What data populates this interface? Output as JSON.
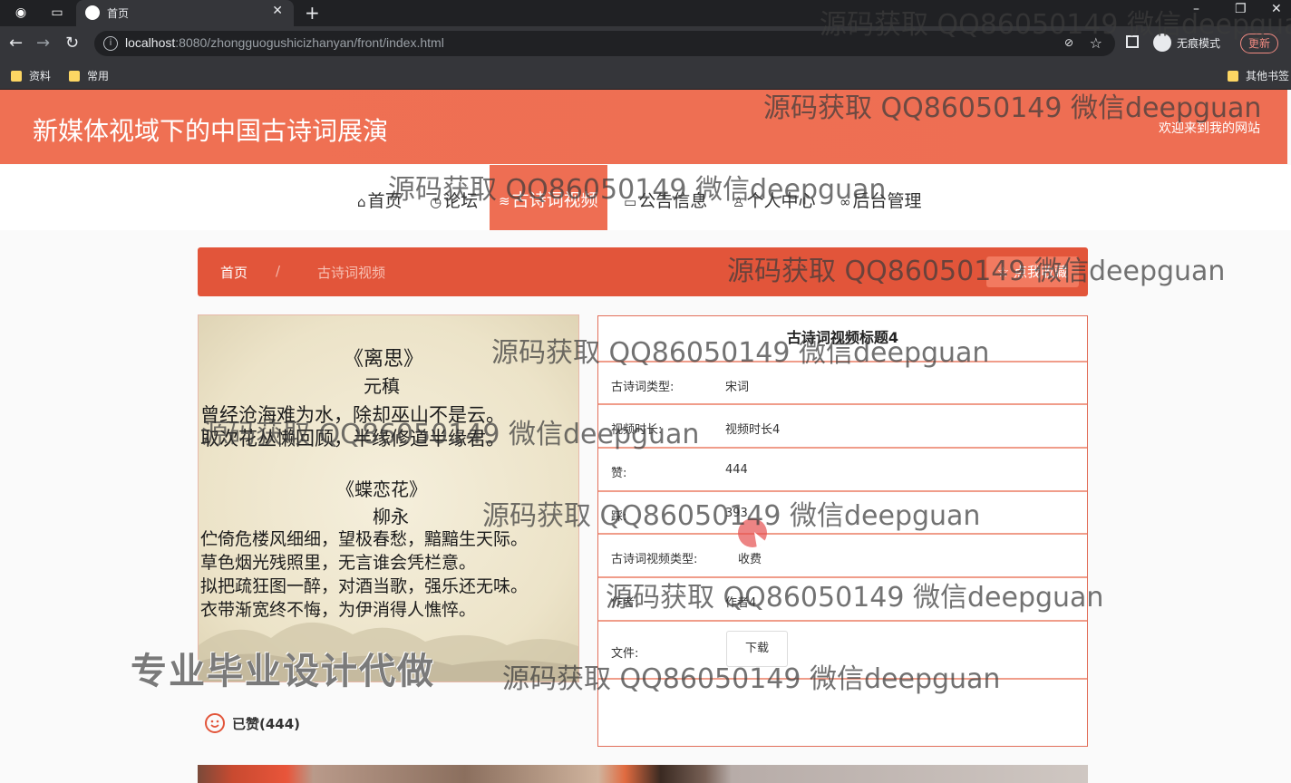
{
  "browser": {
    "tab_title": "首页",
    "url_host": "localhost",
    "url_rest": ":8080/zhongguogushicizhanyan/front/index.html",
    "incognito_label": "无痕模式",
    "update_label": "更新",
    "bookmarks": [
      "资料",
      "常用"
    ],
    "other_bookmarks": "其他书签"
  },
  "site": {
    "title": "新媒体视域下的中国古诗词展演",
    "welcome": "欢迎来到我的网站"
  },
  "nav": {
    "items": [
      "首页",
      "论坛",
      "古诗词视频",
      "公告信息",
      "个人中心",
      "后台管理"
    ],
    "active": "古诗词视频"
  },
  "breadcrumb": {
    "home": "首页",
    "separator": "/",
    "current": "古诗词视频",
    "collect": "☆ 点我收藏"
  },
  "poem": {
    "title1": "《离思》",
    "author1": "元稹",
    "line1": "曾经沧海难为水，除却巫山不是云。",
    "line2": "取次花丛懒回顾，半缘修道半缘君。",
    "title2": "《蝶恋花》",
    "author2": "柳永",
    "line3": "伫倚危楼风细细，望极春愁，黯黯生天际。",
    "line4": "草色烟光残照里，无言谁会凭栏意。",
    "line5": "拟把疏狂图一醉，对酒当歌，强乐还无味。",
    "line6": "衣带渐宽终不悔，为伊消得人憔悴。"
  },
  "like": {
    "label": "已赞(444)"
  },
  "detail": {
    "title": "古诗词视频标题4",
    "rows": [
      {
        "key": "古诗词类型:",
        "value": "宋词"
      },
      {
        "key": "视频时长:",
        "value": "视频时长4"
      },
      {
        "key": "赞:",
        "value": "444"
      },
      {
        "key": "踩:",
        "value": "393"
      },
      {
        "key": "古诗词视频类型:",
        "value": "收费"
      },
      {
        "key": "作者:",
        "value": "作者4"
      },
      {
        "key": "文件:",
        "value": "下载"
      }
    ]
  },
  "watermark": {
    "text": "源码获取 QQ86050149 微信deepguan",
    "stamp": "专业毕业设计代做"
  },
  "colors": {
    "header": "#ee6e53",
    "breadcrumb": "#e2553a",
    "nav_active": "#ee6e53"
  }
}
